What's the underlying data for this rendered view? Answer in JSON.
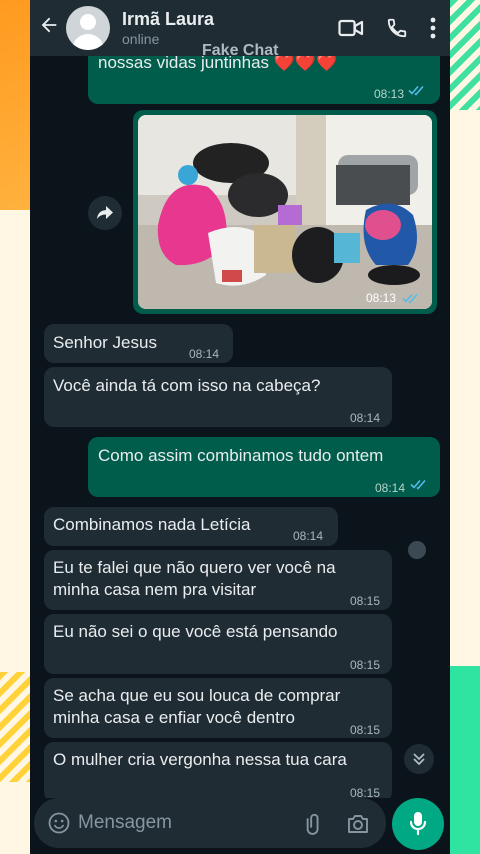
{
  "header": {
    "contact_name": "Irmã Laura",
    "status": "online",
    "watermark": "Fake Chat",
    "icons": [
      "back-arrow-icon",
      "video-call-icon",
      "phone-icon",
      "more-vert-icon"
    ]
  },
  "messages": [
    {
      "direction": "out",
      "text": "nossas vidas juntinhas ❤️❤️❤️",
      "time": "08:13",
      "read": true
    },
    {
      "direction": "out",
      "type": "image",
      "time": "08:13",
      "read": true
    },
    {
      "direction": "in",
      "text": "Senhor Jesus",
      "time": "08:14"
    },
    {
      "direction": "in",
      "text": "Você ainda tá com isso na cabeça?",
      "time": "08:14"
    },
    {
      "direction": "out",
      "text": "Como assim combinamos tudo ontem",
      "time": "08:14",
      "read": true
    },
    {
      "direction": "in",
      "text": "Combinamos nada Letícia",
      "time": "08:14"
    },
    {
      "direction": "in",
      "text": "Eu te falei que não quero ver você na minha casa nem pra visitar",
      "line1": "Eu te falei que não quero ver você na",
      "line2": "minha casa nem pra visitar",
      "time": "08:15"
    },
    {
      "direction": "in",
      "text": "Eu não sei o que você está pensando",
      "time": "08:15"
    },
    {
      "direction": "in",
      "text": "Se acha que eu sou louca de comprar minha casa e enfiar você dentro",
      "line1": "Se acha que eu sou louca de comprar",
      "line2": "minha casa e enfiar você dentro",
      "time": "08:15"
    },
    {
      "direction": "in",
      "text": "O mulher cria vergonha nessa tua cara",
      "time": "08:15"
    }
  ],
  "composer": {
    "placeholder": "Mensagem",
    "icons": [
      "emoji-icon",
      "attach-icon",
      "camera-icon",
      "mic-icon"
    ]
  },
  "colors": {
    "header_bg": "#1f2c33",
    "chat_bg": "#0b141a",
    "incoming_bubble": "#202c33",
    "outgoing_bubble": "#005c4b",
    "read_ticks": "#53bdeb",
    "mic_button": "#00a884"
  }
}
